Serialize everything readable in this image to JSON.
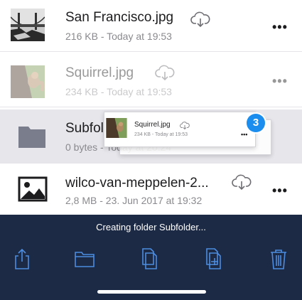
{
  "files": [
    {
      "name": "San Francisco.jpg",
      "meta": "216 KB - Today at 19:53",
      "thumb_icon": "golden-gate-photo-icon",
      "action_icon": "cloud-download-icon",
      "more_label": "•••"
    },
    {
      "name": "Squirrel.jpg",
      "meta": "234 KB - Today at 19:53",
      "thumb_icon": "squirrel-photo-icon",
      "action_icon": "cloud-download-icon",
      "more_label": "•••"
    },
    {
      "name": "Subfolder",
      "meta": "0 bytes - Today at 20:24",
      "thumb_icon": "folder-icon"
    },
    {
      "name": "wilco-van-meppelen-2...",
      "meta": "2,8 MB - 23. Jun 2017 at 19:32",
      "thumb_icon": "image-placeholder-icon",
      "action_icon": "cloud-download-icon",
      "more_label": "•••"
    }
  ],
  "drag": {
    "name": "Squirrel.jpg",
    "meta": "234 KB - Today at 19:53",
    "more_label": "•••",
    "count": "3"
  },
  "toolbar": {
    "status": "Creating folder Subfolder...",
    "tools": [
      "share-icon",
      "folder-icon",
      "copy-icon",
      "add-file-icon",
      "trash-icon"
    ]
  },
  "colors": {
    "accent": "#1a8dee",
    "toolbar_bg": "#1d2a45",
    "icon_blue": "#4d8de0"
  }
}
